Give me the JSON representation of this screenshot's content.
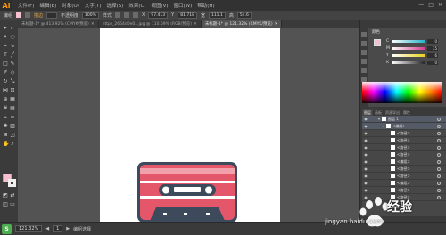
{
  "app": {
    "logo": "Ai",
    "menus": [
      "文件(F)",
      "编辑(E)",
      "对象(O)",
      "文字(T)",
      "选择(S)",
      "效果(C)",
      "视图(V)",
      "窗口(W)",
      "帮助(H)"
    ],
    "window_controls": [
      "—",
      "□",
      "✕"
    ]
  },
  "control_bar": {
    "selection": "编组",
    "stroke_label": "描边",
    "opacity_label": "不透明度",
    "opacity_value": "100%",
    "style_label": "样式",
    "x_label": "X",
    "x_value": "97.413",
    "y_label": "Y",
    "y_value": "81.718",
    "w_label": "宽",
    "w_value": "111.1",
    "h_label": "高",
    "h_value": "54.6"
  },
  "tabs": [
    {
      "label": "未标题-1* @ 413.92% (CMYK/预览)",
      "active": false
    },
    {
      "label": "https_2664d0e0...jpg @ 110.69% (RGB/预览)",
      "active": false
    },
    {
      "label": "未标题-1* @ 121.32% (CMYK/预览)",
      "active": true
    }
  ],
  "color_panel": {
    "title": "颜色",
    "sliders": [
      {
        "label": "C",
        "value": "0",
        "color": "#20b3c8"
      },
      {
        "label": "M",
        "value": "35",
        "color": "#d43a8c"
      },
      {
        "label": "Y",
        "value": "6",
        "color": "#e8d21a"
      },
      {
        "label": "K",
        "value": "0",
        "color": "#444444"
      }
    ],
    "fill_color": "#f6c0cf"
  },
  "layers_panel": {
    "tabs": [
      "图层",
      "画板",
      "资源导出",
      "属性"
    ],
    "active_tab": "图层",
    "rows": [
      {
        "name": "图层 1",
        "selected": true,
        "indent": 0
      },
      {
        "name": "<编组>",
        "selected": true,
        "indent": 1
      },
      {
        "name": "<路径>",
        "selected": false,
        "indent": 2
      },
      {
        "name": "<路径>",
        "selected": false,
        "indent": 2
      },
      {
        "name": "<路径>",
        "selected": false,
        "indent": 2
      },
      {
        "name": "<路径>",
        "selected": false,
        "indent": 2
      },
      {
        "name": "<编组>",
        "selected": false,
        "indent": 2
      },
      {
        "name": "<路径>",
        "selected": false,
        "indent": 2
      },
      {
        "name": "<路径>",
        "selected": false,
        "indent": 2
      },
      {
        "name": "<编组>",
        "selected": false,
        "indent": 2
      },
      {
        "name": "<路径>",
        "selected": false,
        "indent": 2
      },
      {
        "name": "<路径>",
        "selected": false,
        "indent": 2
      }
    ]
  },
  "status_bar": {
    "zoom": "121.32%",
    "page": "1",
    "tool": "编组选择"
  },
  "watermark": {
    "brand": "经验",
    "site": "jingyan.baidu.com"
  }
}
